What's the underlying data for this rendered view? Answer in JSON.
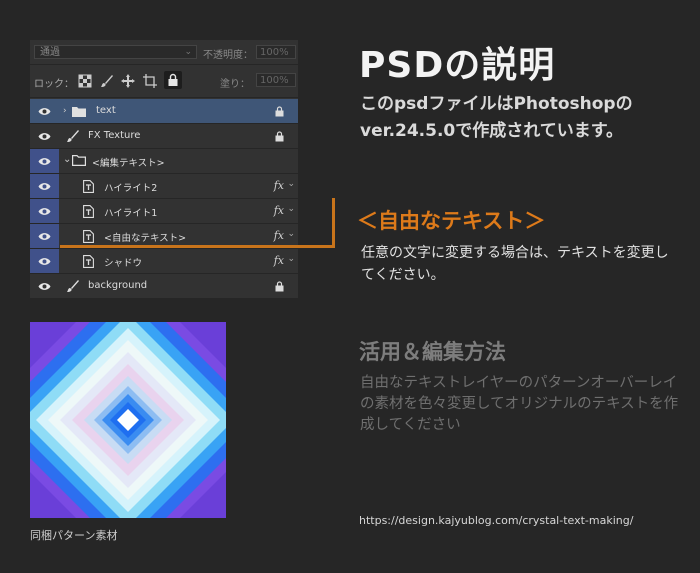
{
  "panel": {
    "blend_mode": "通過",
    "opacity_label": "不透明度：",
    "opacity_value": "100%",
    "lock_label": "ロック：",
    "fill_label": "塗り：",
    "fill_value": "100%",
    "layers": [
      {
        "name": "text"
      },
      {
        "name": "FX Texture"
      },
      {
        "name": "<編集テキスト>"
      },
      {
        "name": "ハイライト2",
        "fx": "fx"
      },
      {
        "name": "ハイライト1",
        "fx": "fx"
      },
      {
        "name": "<自由なテキスト>",
        "fx": "fx"
      },
      {
        "name": "シャドウ",
        "fx": "fx"
      },
      {
        "name": "background"
      }
    ]
  },
  "info": {
    "title": "PSDの説明",
    "description": "このpsdファイルはPhotoshopのver.24.5.0で作成されています。",
    "free_text_title": "＜自由なテキスト＞",
    "free_text_desc": "任意の文字に変更する場合は、テキストを変更してください。",
    "usage_title": "活用＆編集方法",
    "usage_desc": "自由なテキストレイヤーのパターンオーバーレイの素材を色々変更してオリジナルのテキストを作成してください"
  },
  "pattern": {
    "caption": "同梱パターン素材"
  },
  "url": "https://design.kajyublog.com/crystal-text-making/",
  "colors": {
    "accent": "#dd7a1a",
    "selected_layer": "#3f5677",
    "eye_highlight": "#40518a"
  }
}
